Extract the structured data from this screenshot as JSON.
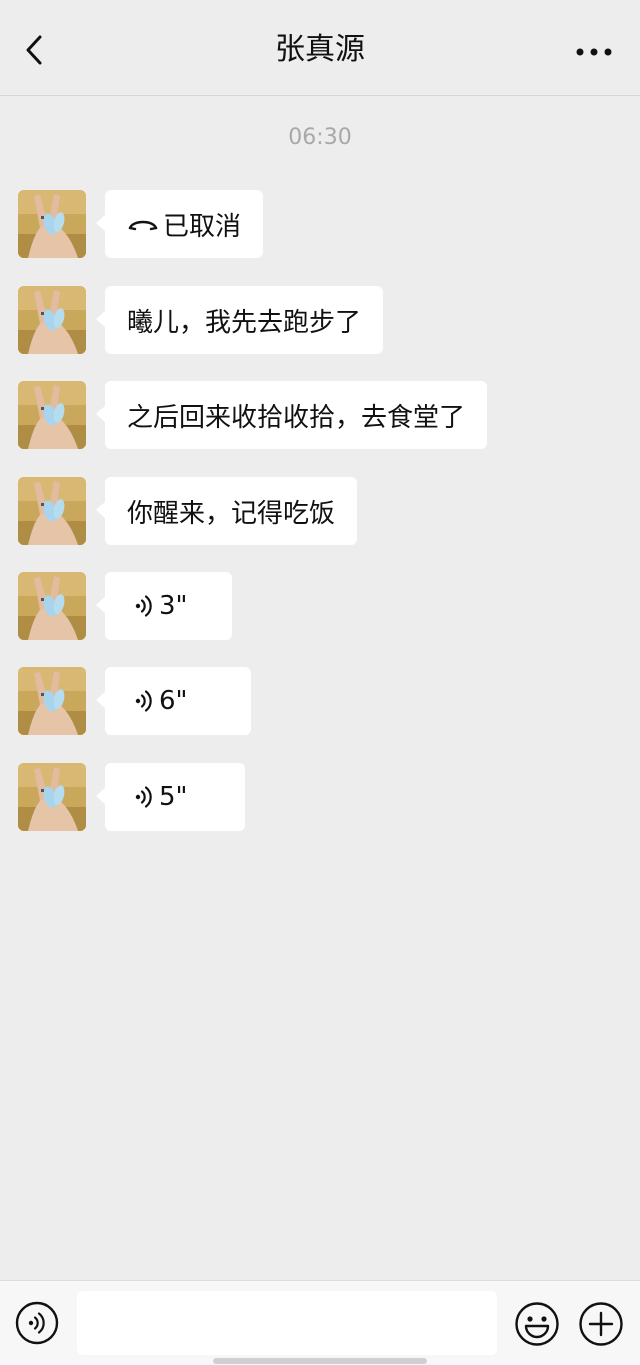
{
  "header": {
    "title": "张真源"
  },
  "chat": {
    "timestamp": "06:30",
    "messages": [
      {
        "type": "call",
        "text": "已取消"
      },
      {
        "type": "text",
        "text": "曦儿，我先去跑步了"
      },
      {
        "type": "text",
        "text": "之后回来收拾收拾，去食堂了"
      },
      {
        "type": "text",
        "text": "你醒来，记得吃饭"
      },
      {
        "type": "voice",
        "text": "3\""
      },
      {
        "type": "voice",
        "text": "6\""
      },
      {
        "type": "voice",
        "text": "5\""
      }
    ]
  },
  "input": {
    "value": ""
  },
  "colors": {
    "background": "#ededed",
    "bubble": "#ffffff",
    "timestamp": "#a8a8a8"
  },
  "icons": {
    "back": "chevron-left-icon",
    "more": "ellipsis-icon",
    "call": "hangup-phone-icon",
    "voice": "voice-wave-icon",
    "emoji": "smiley-icon",
    "plus": "plus-circle-icon"
  }
}
